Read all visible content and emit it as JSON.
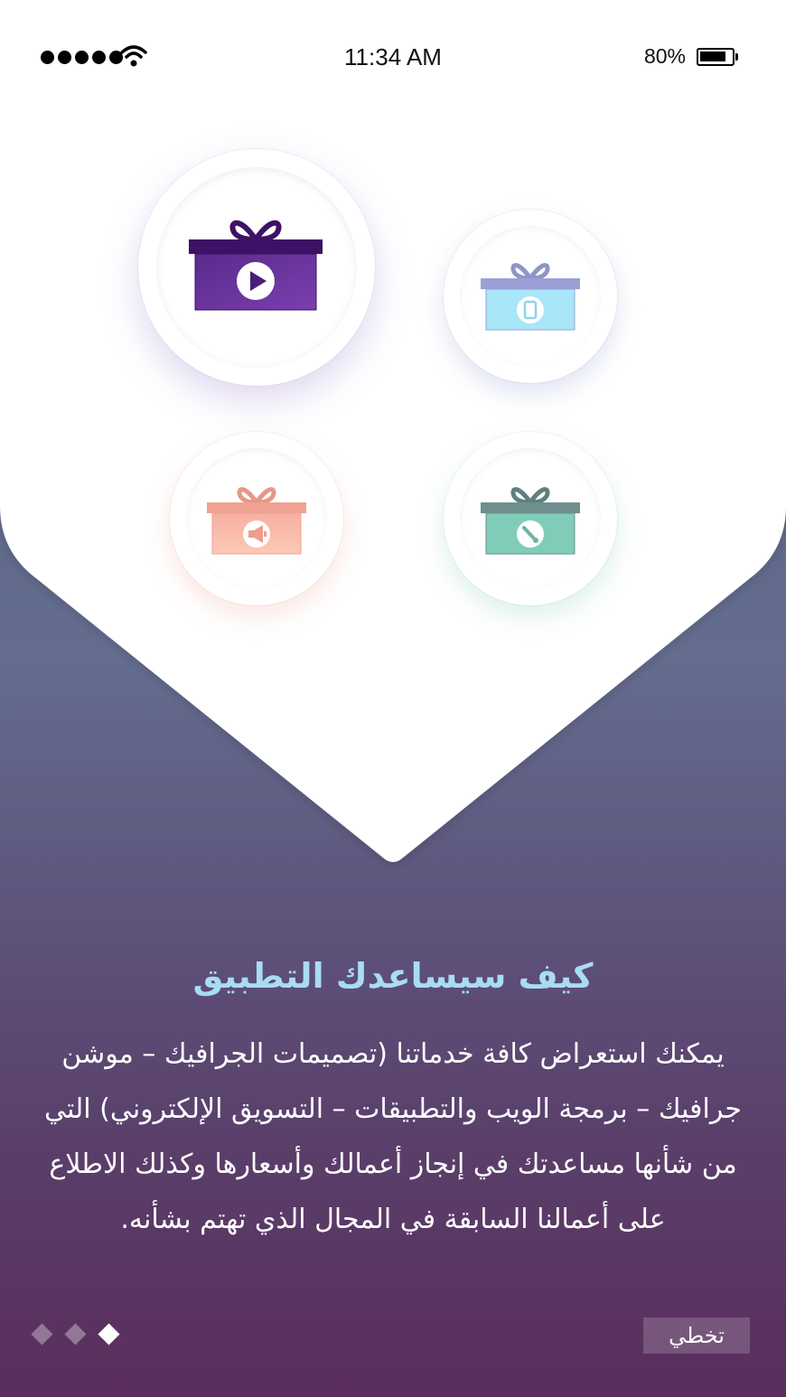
{
  "status_bar": {
    "time": "11:34 AM",
    "battery_percent": "80%",
    "signal_icon": "signal-dots-icon",
    "wifi_icon": "wifi-icon",
    "battery_icon": "battery-icon",
    "battery_level": 0.8
  },
  "services": [
    {
      "name": "video",
      "icon": "play-icon",
      "color": "#5a2a8c"
    },
    {
      "name": "mobile-apps",
      "icon": "mobile-icon",
      "color": "#a8e6f5"
    },
    {
      "name": "marketing",
      "icon": "megaphone-icon",
      "color": "#f7b8a6"
    },
    {
      "name": "graphic-design",
      "icon": "brush-icon",
      "color": "#7fcdb8"
    }
  ],
  "onboarding": {
    "title": "كيف سيساعدك التطبيق",
    "description": "يمكنك استعراض كافة خدماتنا (تصميمات الجرافيك – موشن جرافيك – برمجة الويب والتطبيقات – التسويق الإلكتروني) التي من شأنها مساعدتك في إنجاز أعمالك وأسعارها وكذلك الاطلاع على أعمالنا السابقة في المجال الذي تهتم بشأنه.",
    "skip_label": "تخطي",
    "page_count": 3,
    "active_page": 3
  },
  "colors": {
    "title": "#a9dcf4",
    "background_top": "#4f5a78",
    "background_bottom": "#5a2d5c"
  }
}
